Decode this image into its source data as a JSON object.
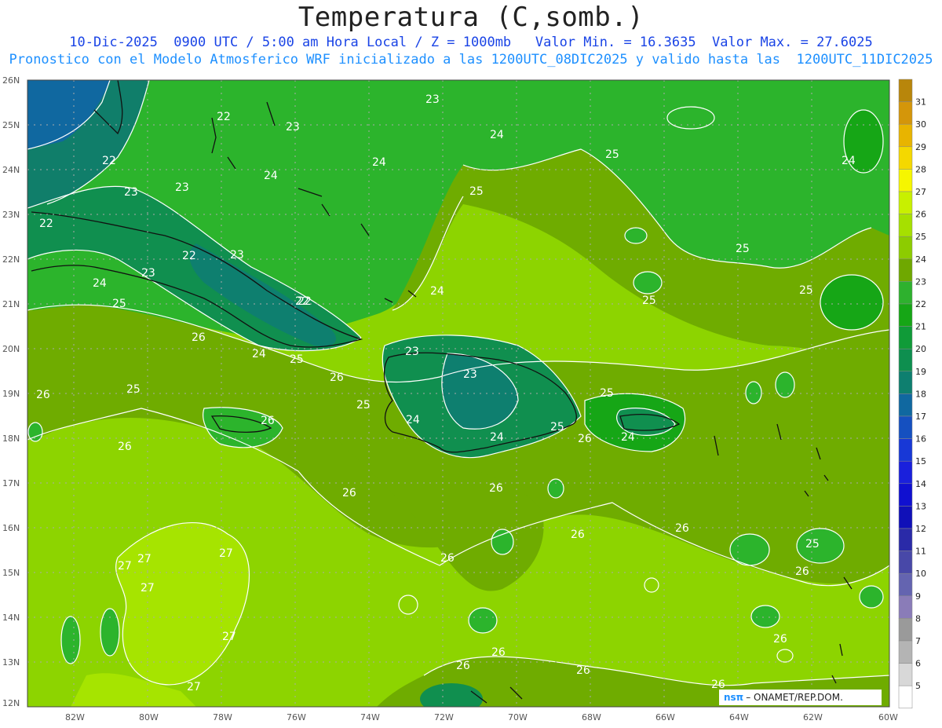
{
  "header": {
    "title": "Temperatura (C,somb.)",
    "line1": "10-Dic-2025  0900 UTC / 5:00 am Hora Local / Z = 1000mb   Valor Min. = 16.3635  Valor Max. = 27.6025",
    "line2": "Pronostico con el Modelo Atmosferico WRF inicializado a las 1200UTC_08DIC2025 y valido hasta las  1200UTC_11DIC2025"
  },
  "map": {
    "lat_labels": [
      "26N",
      "25N",
      "24N",
      "23N",
      "22N",
      "21N",
      "20N",
      "19N",
      "18N",
      "17N",
      "16N",
      "15N",
      "14N",
      "13N",
      "12N"
    ],
    "lon_labels": [
      "82W",
      "80W",
      "78W",
      "76W",
      "74W",
      "72W",
      "70W",
      "68W",
      "66W",
      "64W",
      "62W",
      "60W"
    ],
    "contour_labels": [
      {
        "text": "23"
      },
      {
        "text": "22"
      },
      {
        "text": "22"
      },
      {
        "text": "23"
      },
      {
        "text": "23"
      },
      {
        "text": "24"
      },
      {
        "text": "24"
      },
      {
        "text": "25"
      },
      {
        "text": "24"
      },
      {
        "text": "25"
      },
      {
        "text": "24"
      },
      {
        "text": "22"
      },
      {
        "text": "23"
      },
      {
        "text": "23"
      },
      {
        "text": "22"
      },
      {
        "text": "22"
      },
      {
        "text": "23"
      },
      {
        "text": "24"
      },
      {
        "text": "25"
      },
      {
        "text": "24"
      },
      {
        "text": "25"
      },
      {
        "text": "26"
      },
      {
        "text": "23"
      },
      {
        "text": "24"
      },
      {
        "text": "25"
      },
      {
        "text": "25"
      },
      {
        "text": "26"
      },
      {
        "text": "26"
      },
      {
        "text": "25"
      },
      {
        "text": "26"
      },
      {
        "text": "23"
      },
      {
        "text": "25"
      },
      {
        "text": "24"
      },
      {
        "text": "24"
      },
      {
        "text": "26"
      },
      {
        "text": "24"
      },
      {
        "text": "25"
      },
      {
        "text": "25"
      },
      {
        "text": "26"
      },
      {
        "text": "26"
      },
      {
        "text": "26"
      },
      {
        "text": "25"
      },
      {
        "text": "26"
      },
      {
        "text": "27"
      },
      {
        "text": "27"
      },
      {
        "text": "27"
      },
      {
        "text": "27"
      },
      {
        "text": "26"
      },
      {
        "text": "26"
      },
      {
        "text": "26"
      },
      {
        "text": "26"
      },
      {
        "text": "26"
      },
      {
        "text": "27"
      },
      {
        "text": "26"
      },
      {
        "text": "27"
      },
      {
        "text": "25"
      },
      {
        "text": "26"
      },
      {
        "text": "26"
      },
      {
        "text": "22"
      }
    ],
    "credit_logo": "nsπ",
    "credit_text": "– ONAMET/REP.DOM."
  },
  "colorbar": {
    "levels": [
      "31",
      "30",
      "29",
      "28",
      "27",
      "26",
      "25",
      "24",
      "23",
      "22",
      "21",
      "20",
      "19",
      "18",
      "17",
      "16",
      "15",
      "14",
      "13",
      "12",
      "11",
      "10",
      "9",
      "8",
      "7",
      "6",
      "5"
    ],
    "colors": [
      "#b8860b",
      "#d4960a",
      "#e8b400",
      "#f4d800",
      "#f6f600",
      "#c8f000",
      "#a6e000",
      "#8dcc00",
      "#6fa800",
      "#2eb12e",
      "#16a616",
      "#109b38",
      "#0e8f4f",
      "#0e7f6f",
      "#1068a0",
      "#1550c0",
      "#1838d6",
      "#1a20dc",
      "#1010d0",
      "#1010b8",
      "#2a2aa8",
      "#4848a8",
      "#6464b0",
      "#8a7cb8",
      "#9a9a9a",
      "#b4b4b4",
      "#d8d8d8",
      "#ffffff"
    ]
  }
}
